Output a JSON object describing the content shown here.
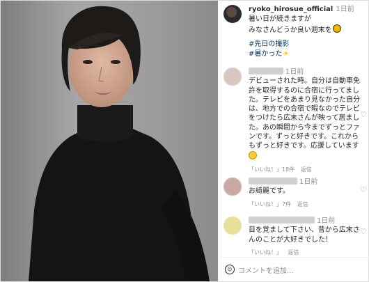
{
  "post": {
    "username": "ryoko_hirosue_official",
    "time": "1日前",
    "caption_line1": "暑い日が続きますが",
    "caption_line2": "みなさんどうか良い週末を",
    "hashtag1": "#先日の撮影",
    "hashtag2": "#暑かった",
    "emoji_bee": "bee-emoji",
    "emoji_sun": "☀"
  },
  "comments": [
    {
      "time": "1日前",
      "text": "デビューされた時。自分は自動車免許を取得するのに合宿に行ってました。テレビをあまり見なかった自分は、地方での合宿で暇なのでテレビをつけたら広末さんが映って居ました。あの瞬間から今までずっとファンです。ずっと好きです。これからもずっと好きです。応援しています",
      "like_label": "「いいね！」18件",
      "reply_label": "返信"
    },
    {
      "time": "1日前",
      "text": "お綺麗です。",
      "like_label": "「いいね！」7件",
      "reply_label": "返信"
    },
    {
      "time": "1日前",
      "text": "目を覚まして下さい、昔から広末さんのことが大好きでした！",
      "like_label": "「いいね！」",
      "reply_label": "返信"
    }
  ],
  "add_comment": {
    "placeholder": "コメントを追加..."
  },
  "icons": {
    "heart": "♡"
  },
  "colors": {
    "hashtag": "#00376b",
    "meta": "#8e8e8e",
    "text": "#262626"
  }
}
